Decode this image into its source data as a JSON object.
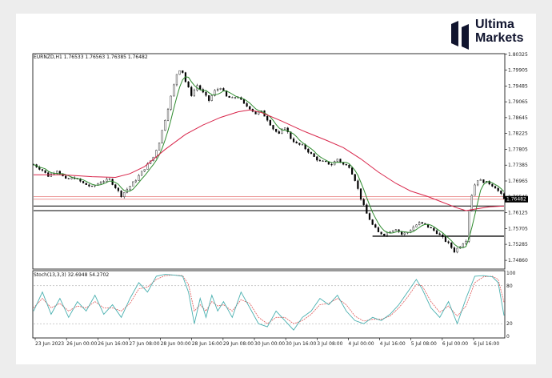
{
  "brand": {
    "line1": "Ultima",
    "line2": "Markets",
    "color": "#10142e"
  },
  "chart_data": [
    {
      "type": "candlestick",
      "symbol_header": "EURNZD,H1  1.76533 1.76563 1.76385 1.76482",
      "current_price_label": "1.76482",
      "ylim": [
        1.7465,
        1.8032
      ],
      "yticks": [
        "1.80325",
        "1.79905",
        "1.79485",
        "1.79065",
        "1.78645",
        "1.78225",
        "1.77805",
        "1.77385",
        "1.76965",
        "1.76545",
        "1.76125",
        "1.75705",
        "1.75285",
        "1.74860"
      ],
      "xticks": [
        "23 Jun 2023",
        "26 Jun 00:00",
        "26 Jun 16:00",
        "27 Jun 08:00",
        "28 Jun 00:00",
        "28 Jun 16:00",
        "29 Jun 08:00",
        "30 Jun 00:00",
        "30 Jun 16:00",
        "3 Jul 08:00",
        "4 Jul 00:00",
        "4 Jul 16:00",
        "5 Jul 08:00",
        "6 Jul 00:00",
        "6 Jul 16:00"
      ],
      "price_path": [
        [
          0,
          1.774
        ],
        [
          6,
          1.7725
        ],
        [
          10,
          1.771
        ],
        [
          16,
          1.7725
        ],
        [
          22,
          1.77
        ],
        [
          28,
          1.7705
        ],
        [
          34,
          1.769
        ],
        [
          40,
          1.768
        ],
        [
          46,
          1.7695
        ],
        [
          52,
          1.77
        ],
        [
          56,
          1.768
        ],
        [
          60,
          1.7658
        ],
        [
          64,
          1.7675
        ],
        [
          70,
          1.77
        ],
        [
          76,
          1.773
        ],
        [
          82,
          1.776
        ],
        [
          86,
          1.78
        ],
        [
          90,
          1.786
        ],
        [
          94,
          1.792
        ],
        [
          98,
          1.798
        ],
        [
          101,
          1.7998
        ],
        [
          104,
          1.796
        ],
        [
          108,
          1.7925
        ],
        [
          112,
          1.795
        ],
        [
          116,
          1.793
        ],
        [
          120,
          1.791
        ],
        [
          124,
          1.7935
        ],
        [
          128,
          1.7945
        ],
        [
          132,
          1.792
        ],
        [
          136,
          1.7915
        ],
        [
          140,
          1.792
        ],
        [
          144,
          1.79
        ],
        [
          148,
          1.789
        ],
        [
          152,
          1.7875
        ],
        [
          156,
          1.788
        ],
        [
          160,
          1.786
        ],
        [
          164,
          1.7835
        ],
        [
          168,
          1.782
        ],
        [
          172,
          1.784
        ],
        [
          176,
          1.781
        ],
        [
          180,
          1.7795
        ],
        [
          184,
          1.779
        ],
        [
          188,
          1.7775
        ],
        [
          192,
          1.776
        ],
        [
          196,
          1.7748
        ],
        [
          200,
          1.7745
        ],
        [
          204,
          1.774
        ],
        [
          208,
          1.7755
        ],
        [
          212,
          1.774
        ],
        [
          216,
          1.7735
        ],
        [
          220,
          1.77
        ],
        [
          224,
          1.765
        ],
        [
          228,
          1.761
        ],
        [
          232,
          1.758
        ],
        [
          236,
          1.756
        ],
        [
          240,
          1.7555
        ],
        [
          244,
          1.7565
        ],
        [
          248,
          1.757
        ],
        [
          252,
          1.7555
        ],
        [
          256,
          1.756
        ],
        [
          260,
          1.7575
        ],
        [
          264,
          1.7585
        ],
        [
          268,
          1.758
        ],
        [
          272,
          1.757
        ],
        [
          276,
          1.756
        ],
        [
          280,
          1.7545
        ],
        [
          284,
          1.753
        ],
        [
          288,
          1.751
        ],
        [
          292,
          1.7525
        ],
        [
          296,
          1.754
        ],
        [
          298,
          1.762
        ],
        [
          301,
          1.768
        ],
        [
          304,
          1.77
        ],
        [
          308,
          1.7695
        ],
        [
          312,
          1.769
        ],
        [
          316,
          1.768
        ],
        [
          320,
          1.766
        ],
        [
          322,
          1.7648
        ]
      ],
      "ma_path": [
        [
          0,
          1.7713
        ],
        [
          20,
          1.7713
        ],
        [
          40,
          1.7708
        ],
        [
          56,
          1.7706
        ],
        [
          66,
          1.7716
        ],
        [
          76,
          1.7735
        ],
        [
          90,
          1.778
        ],
        [
          104,
          1.782
        ],
        [
          116,
          1.7845
        ],
        [
          128,
          1.7865
        ],
        [
          140,
          1.788
        ],
        [
          148,
          1.7885
        ],
        [
          156,
          1.7878
        ],
        [
          170,
          1.7855
        ],
        [
          184,
          1.783
        ],
        [
          200,
          1.7805
        ],
        [
          212,
          1.7785
        ],
        [
          224,
          1.7755
        ],
        [
          236,
          1.772
        ],
        [
          248,
          1.769
        ],
        [
          258,
          1.767
        ],
        [
          270,
          1.7655
        ],
        [
          280,
          1.764
        ],
        [
          290,
          1.7625
        ],
        [
          296,
          1.7618
        ],
        [
          302,
          1.7622
        ],
        [
          312,
          1.7628
        ],
        [
          322,
          1.763
        ]
      ],
      "hlines": [
        {
          "y": 1.7655,
          "color": "#e05a5a",
          "width": 0.6
        },
        {
          "y": 1.7648,
          "color": "#e05a5a",
          "width": 0.6
        },
        {
          "y": 1.763,
          "color": "#000000",
          "width": 1
        },
        {
          "y": 1.7618,
          "color": "#000000",
          "width": 1
        }
      ],
      "support_segments": [
        {
          "x0": 232,
          "x1": 322,
          "y": 1.755,
          "color": "#000000",
          "width": 1.4
        }
      ]
    },
    {
      "type": "line",
      "indicator_header": "Stoch(13,3,3) 32.6948 54.2702",
      "ylim": [
        0,
        100
      ],
      "levels": [
        80,
        20
      ],
      "yticks": [
        "100",
        "80",
        "20",
        "0"
      ],
      "main_series": [
        [
          0,
          40
        ],
        [
          6,
          70
        ],
        [
          12,
          35
        ],
        [
          18,
          60
        ],
        [
          24,
          30
        ],
        [
          30,
          55
        ],
        [
          36,
          40
        ],
        [
          42,
          65
        ],
        [
          48,
          35
        ],
        [
          54,
          50
        ],
        [
          60,
          30
        ],
        [
          66,
          60
        ],
        [
          72,
          85
        ],
        [
          78,
          70
        ],
        [
          84,
          95
        ],
        [
          90,
          98
        ],
        [
          96,
          97
        ],
        [
          102,
          95
        ],
        [
          106,
          70
        ],
        [
          110,
          20
        ],
        [
          114,
          60
        ],
        [
          118,
          30
        ],
        [
          122,
          65
        ],
        [
          126,
          40
        ],
        [
          130,
          55
        ],
        [
          136,
          30
        ],
        [
          142,
          70
        ],
        [
          148,
          45
        ],
        [
          154,
          20
        ],
        [
          160,
          15
        ],
        [
          166,
          40
        ],
        [
          172,
          25
        ],
        [
          178,
          10
        ],
        [
          184,
          30
        ],
        [
          190,
          40
        ],
        [
          196,
          60
        ],
        [
          202,
          50
        ],
        [
          208,
          65
        ],
        [
          214,
          40
        ],
        [
          220,
          25
        ],
        [
          226,
          20
        ],
        [
          232,
          30
        ],
        [
          238,
          25
        ],
        [
          244,
          35
        ],
        [
          250,
          50
        ],
        [
          256,
          70
        ],
        [
          262,
          90
        ],
        [
          266,
          75
        ],
        [
          272,
          45
        ],
        [
          278,
          30
        ],
        [
          284,
          55
        ],
        [
          290,
          20
        ],
        [
          296,
          60
        ],
        [
          302,
          95
        ],
        [
          308,
          96
        ],
        [
          314,
          94
        ],
        [
          318,
          85
        ],
        [
          322,
          33
        ]
      ],
      "signal_series": [
        [
          0,
          45
        ],
        [
          6,
          60
        ],
        [
          12,
          45
        ],
        [
          18,
          52
        ],
        [
          24,
          40
        ],
        [
          30,
          48
        ],
        [
          36,
          45
        ],
        [
          42,
          55
        ],
        [
          48,
          45
        ],
        [
          54,
          45
        ],
        [
          60,
          40
        ],
        [
          66,
          52
        ],
        [
          72,
          75
        ],
        [
          78,
          78
        ],
        [
          84,
          90
        ],
        [
          90,
          96
        ],
        [
          96,
          97
        ],
        [
          102,
          96
        ],
        [
          106,
          82
        ],
        [
          110,
          40
        ],
        [
          114,
          50
        ],
        [
          118,
          40
        ],
        [
          122,
          55
        ],
        [
          126,
          48
        ],
        [
          130,
          50
        ],
        [
          136,
          40
        ],
        [
          142,
          58
        ],
        [
          148,
          52
        ],
        [
          154,
          30
        ],
        [
          160,
          20
        ],
        [
          166,
          30
        ],
        [
          172,
          30
        ],
        [
          178,
          20
        ],
        [
          184,
          25
        ],
        [
          190,
          35
        ],
        [
          196,
          50
        ],
        [
          202,
          52
        ],
        [
          208,
          60
        ],
        [
          214,
          50
        ],
        [
          220,
          32
        ],
        [
          226,
          24
        ],
        [
          232,
          27
        ],
        [
          238,
          27
        ],
        [
          244,
          32
        ],
        [
          250,
          45
        ],
        [
          256,
          62
        ],
        [
          262,
          82
        ],
        [
          266,
          80
        ],
        [
          272,
          55
        ],
        [
          278,
          38
        ],
        [
          284,
          48
        ],
        [
          290,
          32
        ],
        [
          296,
          48
        ],
        [
          302,
          85
        ],
        [
          308,
          94
        ],
        [
          314,
          95
        ],
        [
          318,
          90
        ],
        [
          322,
          54
        ]
      ]
    }
  ]
}
